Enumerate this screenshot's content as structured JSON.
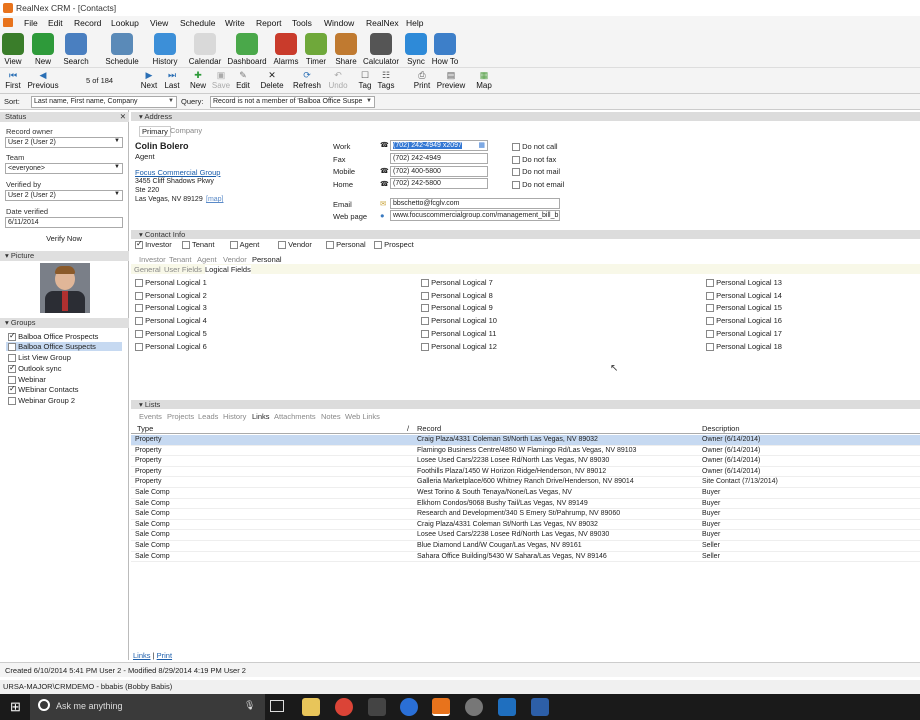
{
  "window": {
    "title": "RealNex CRM - [Contacts]"
  },
  "menu": [
    "File",
    "Edit",
    "Record",
    "Lookup",
    "View",
    "Schedule",
    "Write",
    "Report",
    "Tools",
    "Window",
    "RealNex",
    "Help"
  ],
  "ribbon": [
    {
      "label": "View",
      "icon": "view-icon",
      "color": "#3a7d2a"
    },
    {
      "label": "New",
      "icon": "new-icon",
      "color": "#2e9a3a"
    },
    {
      "label": "Search",
      "icon": "search-icon",
      "color": "#4a7fc0"
    },
    {
      "label": "Schedule",
      "icon": "schedule-icon",
      "color": "#5a8ab8"
    },
    {
      "label": "History",
      "icon": "history-icon",
      "color": "#3c8fd8"
    },
    {
      "label": "Calendar",
      "icon": "calendar-icon",
      "color": "#d9d9d9"
    },
    {
      "label": "Dashboard",
      "icon": "dashboard-icon",
      "color": "#4aa84a"
    },
    {
      "label": "Alarms",
      "icon": "alarm-icon",
      "color": "#c93b2b"
    },
    {
      "label": "Timer",
      "icon": "timer-icon",
      "color": "#6fa83a"
    },
    {
      "label": "Share",
      "icon": "share-icon",
      "color": "#c07a30"
    },
    {
      "label": "Calculator",
      "icon": "calculator-icon",
      "color": "#555555"
    },
    {
      "label": "Sync",
      "icon": "sync-icon",
      "color": "#2e8ad8"
    },
    {
      "label": "How To",
      "icon": "how-to-icon",
      "color": "#3d7fc9"
    }
  ],
  "nav": {
    "first": "First",
    "previous": "Previous",
    "record_count": "5 of 184",
    "next": "Next",
    "last": "Last",
    "new": "New",
    "save": "Save",
    "edit": "Edit",
    "delete": "Delete",
    "refresh": "Refresh",
    "undo": "Undo",
    "tag": "Tag",
    "tags": "Tags",
    "print": "Print",
    "preview": "Preview",
    "map": "Map"
  },
  "sortbar": {
    "sort_label": "Sort:",
    "sort_value": "Last name, First name, Company",
    "query_label": "Query:",
    "query_value": "Record is not a member of 'Balboa Office Suspe"
  },
  "left": {
    "status_header": "Status",
    "record_owner_label": "Record owner",
    "record_owner": "User 2 (User 2)",
    "team_label": "Team",
    "team": "<everyone>",
    "verified_by_label": "Verified by",
    "verified_by": "User 2 (User 2)",
    "date_verified_label": "Date verified",
    "date_verified": "6/11/2014",
    "verify_now": "Verify Now",
    "picture_header": "Picture",
    "groups_header": "Groups",
    "groups": [
      {
        "name": "Balboa Office Prospects",
        "checked": true
      },
      {
        "name": "Balboa Office Suspects",
        "checked": false,
        "selected": true
      },
      {
        "name": "List View Group",
        "checked": false
      },
      {
        "name": "Outlook sync",
        "checked": true
      },
      {
        "name": "Webinar",
        "checked": false
      },
      {
        "name": "WEbinar Contacts",
        "checked": true
      },
      {
        "name": "Webinar Group 2",
        "checked": false
      }
    ]
  },
  "address": {
    "header": "Address",
    "tab_primary": "Primary",
    "tab_company": "Company",
    "name": "Colin Bolero",
    "title": "Agent",
    "company": "Focus Commercial Group",
    "street": "3455 Cliff Shadows Pkwy",
    "suite": "Ste 220",
    "city": "Las Vegas, NV 89129",
    "map": "[map]",
    "phones": [
      {
        "label": "Work",
        "value": "(702) 242-4949 x2097"
      },
      {
        "label": "Fax",
        "value": "(702) 242-4949"
      },
      {
        "label": "Mobile",
        "value": "(702) 400-5800"
      },
      {
        "label": "Home",
        "value": "(702) 242-5800"
      }
    ],
    "dnc": [
      "Do not call",
      "Do not fax",
      "Do not mail",
      "Do not email"
    ],
    "email_label": "Email",
    "email": "bbschetto@fcglv.com",
    "web_label": "Web page",
    "web": "www.focuscommercialgroup.com/management_bill_b"
  },
  "contact_info": {
    "header": "Contact Info",
    "types": [
      {
        "label": "Investor",
        "checked": true
      },
      {
        "label": "Tenant",
        "checked": false
      },
      {
        "label": "Agent",
        "checked": false
      },
      {
        "label": "Vendor",
        "checked": false
      },
      {
        "label": "Personal",
        "checked": false
      },
      {
        "label": "Prospect",
        "checked": false
      }
    ],
    "subtabs": [
      "Investor",
      "Tenant",
      "Agent",
      "Vendor",
      "Personal"
    ],
    "fieldtabs": [
      "General",
      "User Fields",
      "Logical Fields"
    ],
    "logicals": [
      "Personal Logical 1",
      "Personal Logical 2",
      "Personal Logical 3",
      "Personal Logical 4",
      "Personal Logical 5",
      "Personal Logical 6",
      "Personal Logical 7",
      "Personal Logical 8",
      "Personal Logical 9",
      "Personal Logical 10",
      "Personal Logical 11",
      "Personal Logical 12",
      "Personal Logical 13",
      "Personal Logical 14",
      "Personal Logical 15",
      "Personal Logical 16",
      "Personal Logical 17",
      "Personal Logical 18"
    ]
  },
  "lists": {
    "header": "Lists",
    "tabs": [
      "Events",
      "Projects",
      "Leads",
      "History",
      "Links",
      "Attachments",
      "Notes",
      "Web Links"
    ],
    "columns": [
      "Type",
      "Record",
      "Description"
    ],
    "rows": [
      [
        "Property",
        "Craig Plaza/4331 Coleman St/North Las Vegas, NV 89032",
        "Owner (6/14/2014)"
      ],
      [
        "Property",
        "Flamingo Business Centre/4850 W Flamingo Rd/Las Vegas, NV 89103",
        "Owner (6/14/2014)"
      ],
      [
        "Property",
        "Losee Used Cars/2238 Losee Rd/North Las Vegas, NV 89030",
        "Owner (6/14/2014)"
      ],
      [
        "Property",
        "Foothills Plaza/1450 W Horizon Ridge/Henderson, NV 89012",
        "Owner (6/14/2014)"
      ],
      [
        "Property",
        "Galleria Marketplace/600 Whitney Ranch Drive/Henderson, NV 89014",
        "Site Contact (7/13/2014)"
      ],
      [
        "Sale Comp",
        "West Torino & South Tenaya/None/Las Vegas, NV",
        "Buyer"
      ],
      [
        "Sale Comp",
        "Elkhorn Condos/9068 Bushy Tail/Las Vegas, NV 89149",
        "Buyer"
      ],
      [
        "Sale Comp",
        "Research and Development/340 S Emery St/Pahrump, NV 89060",
        "Buyer"
      ],
      [
        "Sale Comp",
        "Craig Plaza/4331 Coleman St/North Las Vegas, NV 89032",
        "Buyer"
      ],
      [
        "Sale Comp",
        "Losee Used Cars/2238 Losee Rd/North Las Vegas, NV 89030",
        "Buyer"
      ],
      [
        "Sale Comp",
        "Blue Diamond Land/W Cougar/Las Vegas, NV 89161",
        "Seller"
      ],
      [
        "Sale Comp",
        "Sahara Office Building/5430 W Sahara/Las Vegas, NV 89146",
        "Seller"
      ]
    ],
    "footer_links": "Links",
    "footer_print": "Print"
  },
  "status": {
    "created": "Created 6/10/2014 5:41 PM User 2 - Modified 8/29/2014 4:19 PM User 2",
    "db": "URSA-MAJOR\\CRMDEMO - bbabis (Bobby Babis)"
  },
  "taskbar": {
    "search_placeholder": "Ask me anything"
  }
}
